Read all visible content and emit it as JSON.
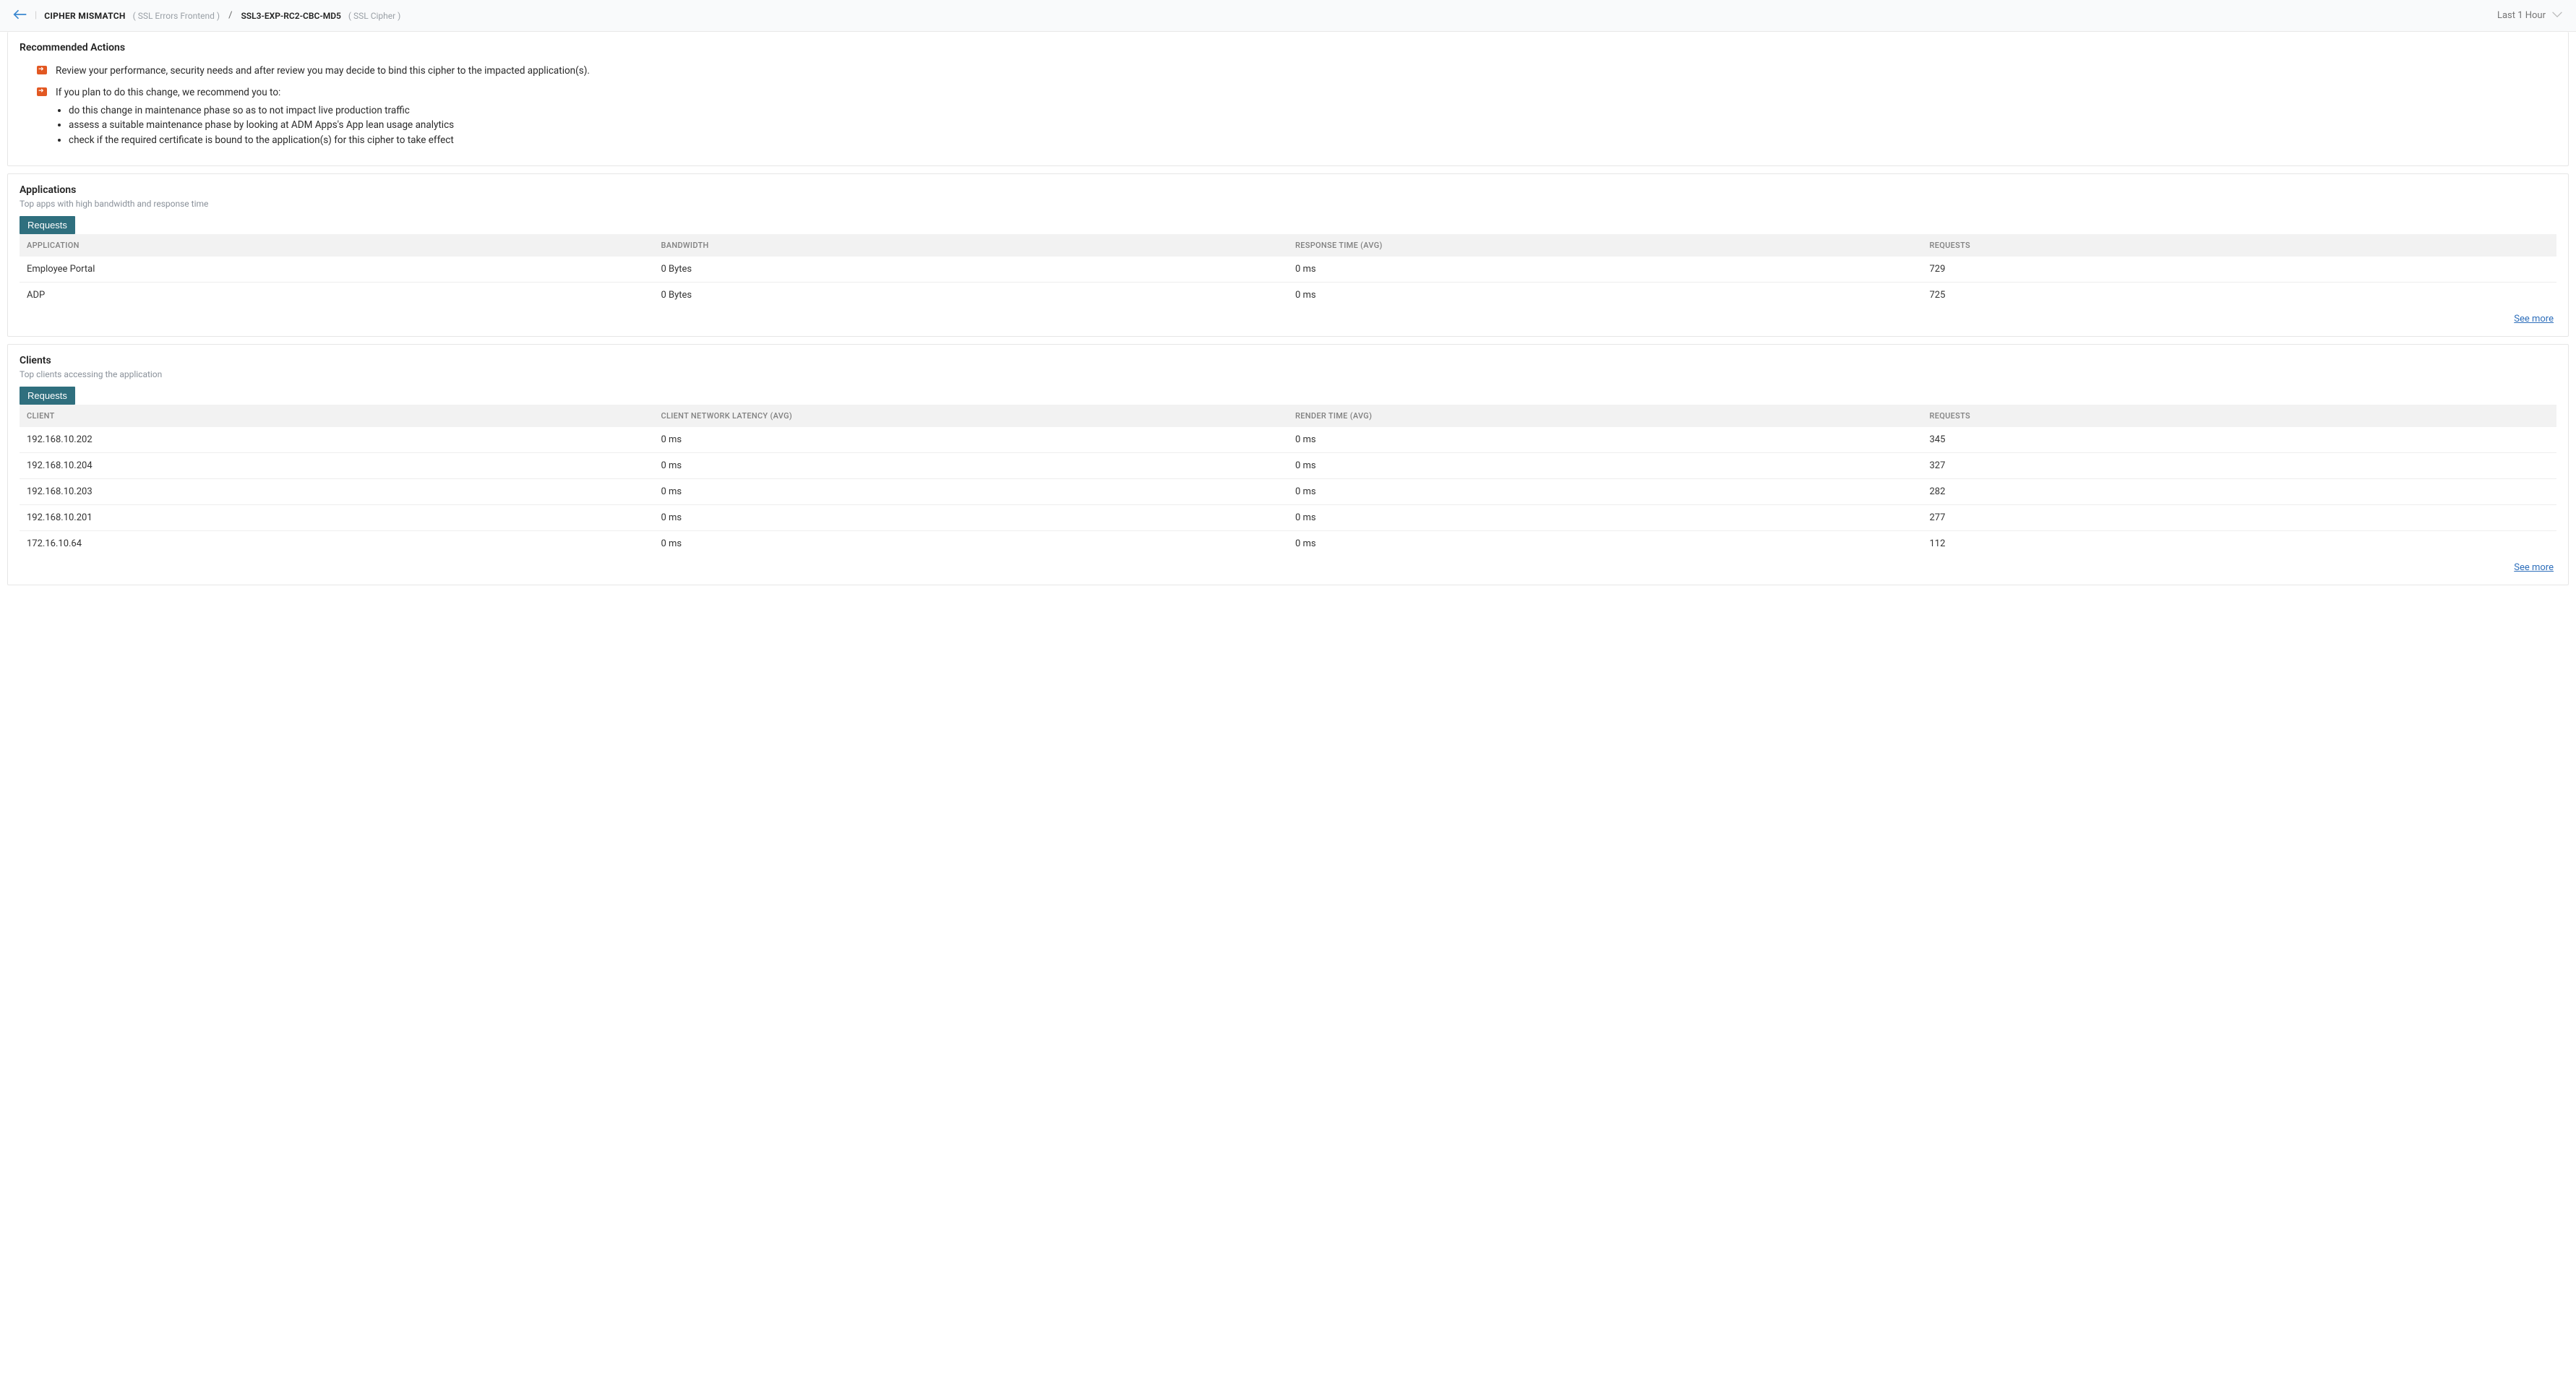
{
  "header": {
    "crumb_main": "CIPHER MISMATCH",
    "crumb_main_sub": "( SSL Errors Frontend )",
    "slash": "/",
    "crumb_second": "SSL3-EXP-RC2-CBC-MD5",
    "crumb_second_sub": "( SSL Cipher )",
    "time_range": "Last 1 Hour"
  },
  "recommended": {
    "title": "Recommended Actions",
    "items": [
      {
        "text": "Review your performance, security needs and after review you may decide to bind this cipher to the impacted application(s)."
      },
      {
        "text": "If you plan to do this change, we recommend you to:",
        "sub": [
          "do this change in maintenance phase so as to not impact live production traffic",
          "assess a suitable maintenance phase by looking at ADM Apps's App lean usage analytics",
          "check if the required certificate is bound to the application(s) for this cipher to take effect"
        ]
      }
    ]
  },
  "apps": {
    "title": "Applications",
    "subtitle": "Top apps with high bandwidth and response time",
    "button": "Requests",
    "columns": [
      "APPLICATION",
      "BANDWIDTH",
      "RESPONSE TIME (AVG)",
      "REQUESTS"
    ],
    "rows": [
      {
        "c0": "Employee Portal",
        "c1": "0 Bytes",
        "c2": "0 ms",
        "c3": "729"
      },
      {
        "c0": "ADP",
        "c1": "0 Bytes",
        "c2": "0 ms",
        "c3": "725"
      }
    ],
    "see_more": "See more"
  },
  "clients": {
    "title": "Clients",
    "subtitle": "Top clients accessing the application",
    "button": "Requests",
    "columns": [
      "CLIENT",
      "CLIENT NETWORK LATENCY (AVG)",
      "RENDER TIME (AVG)",
      "REQUESTS"
    ],
    "rows": [
      {
        "c0": "192.168.10.202",
        "c1": "0 ms",
        "c2": "0 ms",
        "c3": "345"
      },
      {
        "c0": "192.168.10.204",
        "c1": "0 ms",
        "c2": "0 ms",
        "c3": "327"
      },
      {
        "c0": "192.168.10.203",
        "c1": "0 ms",
        "c2": "0 ms",
        "c3": "282"
      },
      {
        "c0": "192.168.10.201",
        "c1": "0 ms",
        "c2": "0 ms",
        "c3": "277"
      },
      {
        "c0": "172.16.10.64",
        "c1": "0 ms",
        "c2": "0 ms",
        "c3": "112"
      }
    ],
    "see_more": "See more"
  }
}
